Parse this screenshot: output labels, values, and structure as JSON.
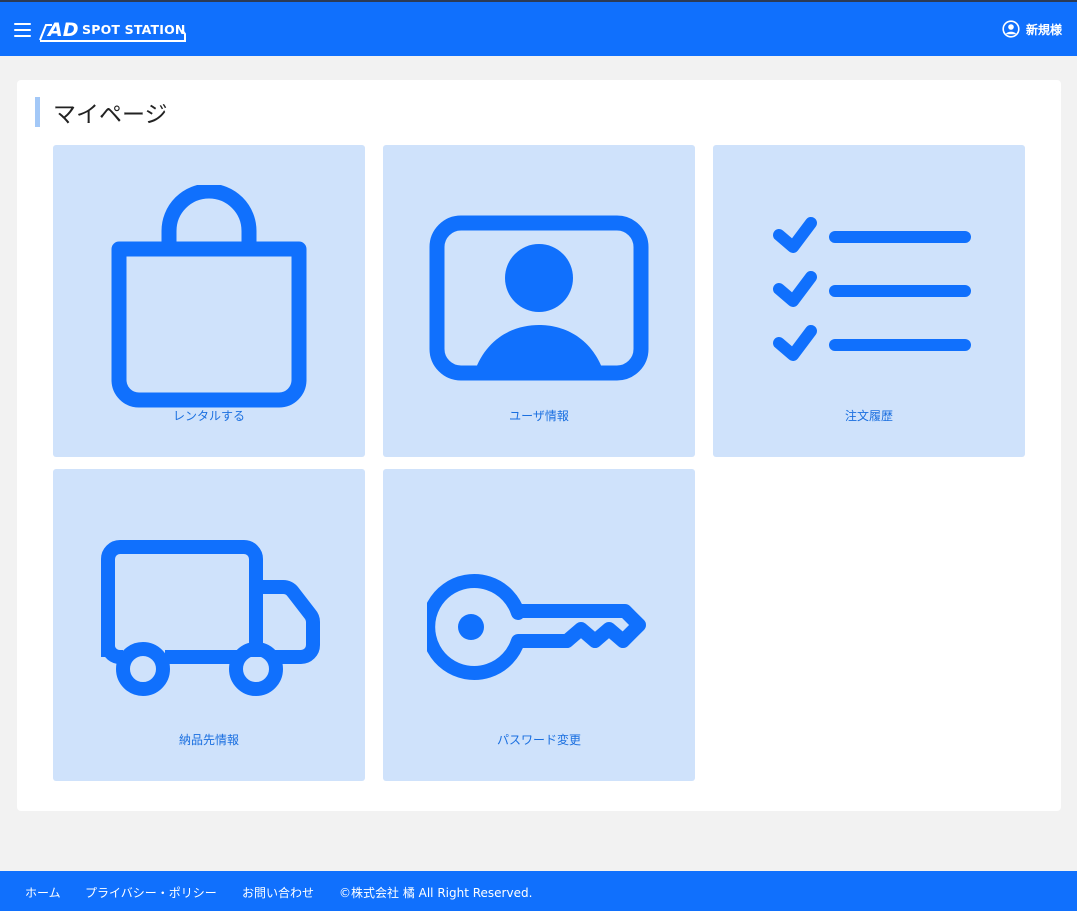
{
  "header": {
    "logo_text": "SPOT STATION",
    "user_name": "新規様",
    "menu_icon": "hamburger-menu-icon",
    "user_icon": "user-circle-icon"
  },
  "main": {
    "page_title": "マイページ",
    "tiles": [
      {
        "label": "レンタルする",
        "icon": "shopping-bag-icon"
      },
      {
        "label": "ユーザ情報",
        "icon": "person-badge-icon"
      },
      {
        "label": "注文履歴",
        "icon": "checklist-icon"
      },
      {
        "label": "納品先情報",
        "icon": "truck-icon"
      },
      {
        "label": "パスワード変更",
        "icon": "key-icon"
      }
    ]
  },
  "footer": {
    "links": [
      "ホーム",
      "プライバシー・ポリシー",
      "お問い合わせ"
    ],
    "copyright": "©株式会社 橘 All Right Reserved."
  },
  "colors": {
    "primary": "#1070fd",
    "tile_bg": "#cfe2fb",
    "page_bg": "#f2f2f2",
    "title_accent": "#a3c8f7"
  }
}
